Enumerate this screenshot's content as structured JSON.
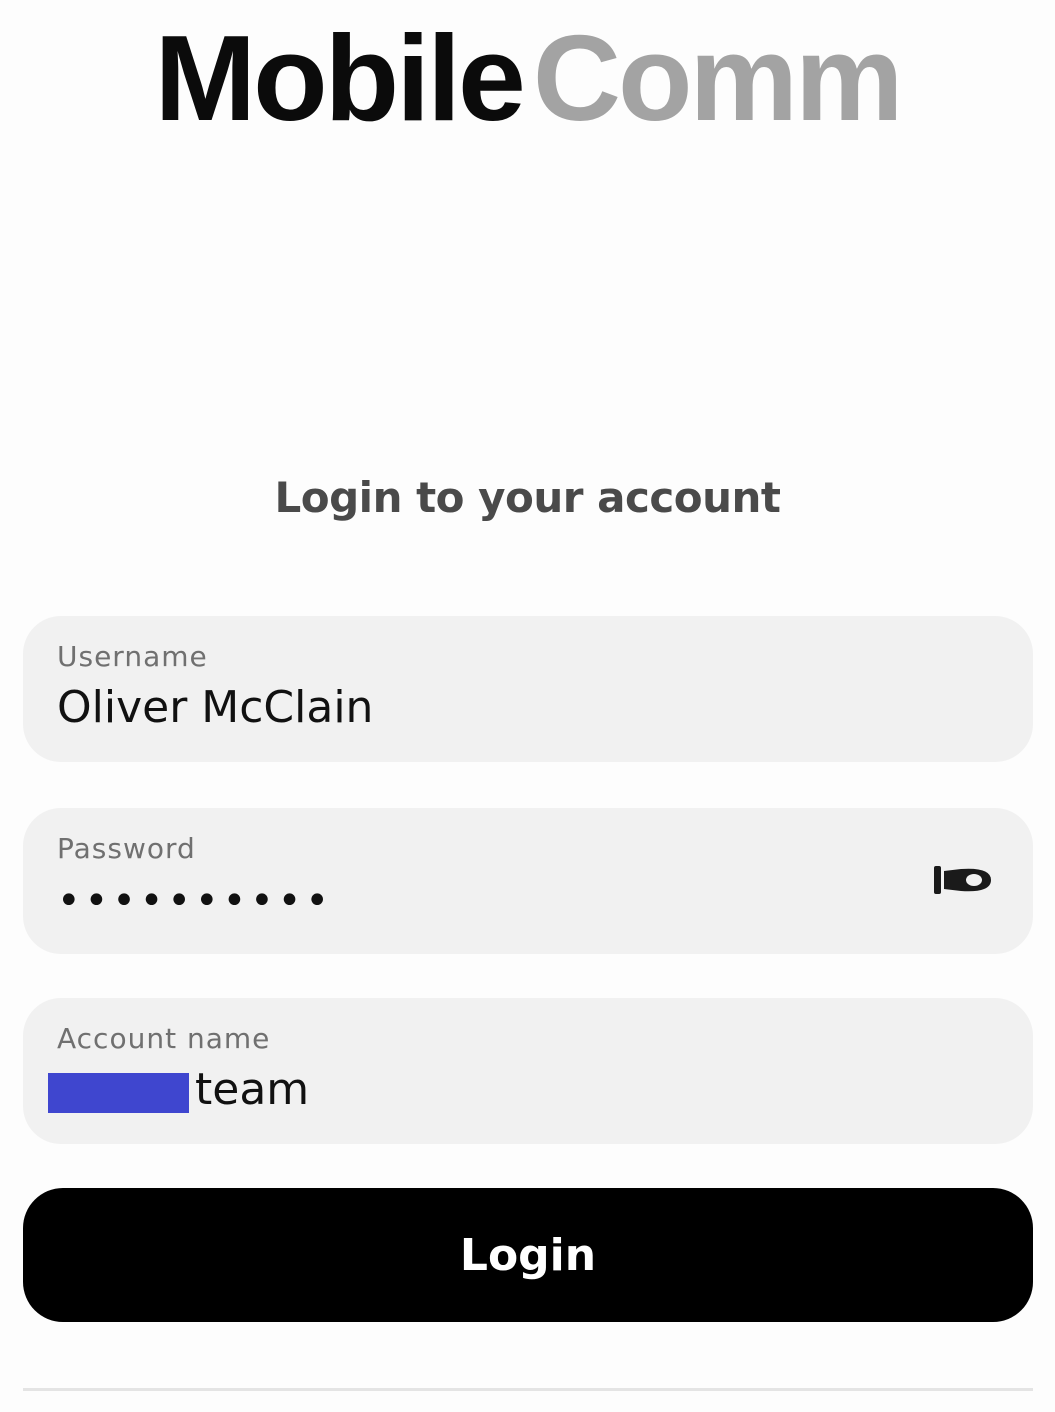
{
  "logo": {
    "part1": "Mobile",
    "part2": "Comm"
  },
  "heading": "Login to your account",
  "form": {
    "username": {
      "label": "Username",
      "value": "Oliver McClain"
    },
    "password": {
      "label": "Password",
      "value": "••••••••••",
      "toggle_icon": "eye-icon"
    },
    "account": {
      "label": "Account name",
      "value_suffix": "team",
      "redaction_color": "#3f46cf"
    }
  },
  "login_button": {
    "label": "Login"
  },
  "colors": {
    "logo_primary": "#0b0b0b",
    "logo_secondary": "#a3a3a3",
    "field_background": "#f1f1f1",
    "button_background": "#000000"
  }
}
